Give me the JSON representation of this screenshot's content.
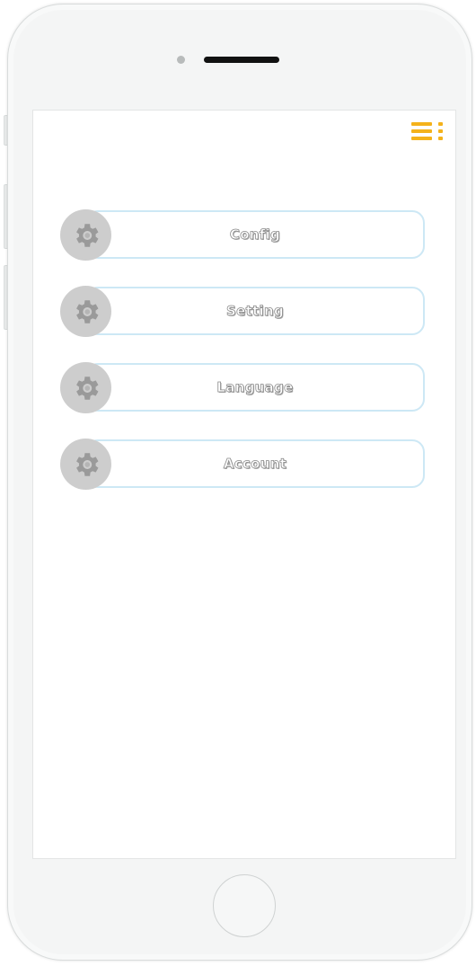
{
  "theme": {
    "accent": "#f4b21b",
    "pill_border": "#cde8f5",
    "gear_bg": "#cdcdcd"
  },
  "header": {
    "menu_icon": "hamburger-menu-icon"
  },
  "menu": {
    "items": [
      {
        "label": "Config",
        "icon": "gear-icon"
      },
      {
        "label": "Setting",
        "icon": "gear-icon"
      },
      {
        "label": "Language",
        "icon": "gear-icon"
      },
      {
        "label": "Account",
        "icon": "gear-icon"
      }
    ]
  }
}
